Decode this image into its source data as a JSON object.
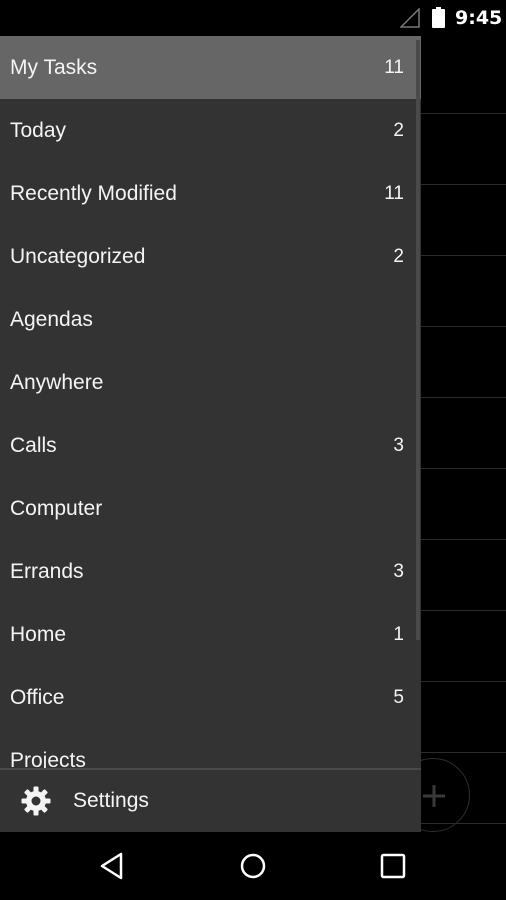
{
  "status_bar": {
    "time": "9:45"
  },
  "drawer": {
    "items": [
      {
        "label": "My Tasks",
        "count": "11",
        "active": true
      },
      {
        "label": "Today",
        "count": "2"
      },
      {
        "label": "Recently Modified",
        "count": "11"
      },
      {
        "label": "Uncategorized",
        "count": "2"
      },
      {
        "label": "Agendas",
        "count": ""
      },
      {
        "label": "Anywhere",
        "count": ""
      },
      {
        "label": "Calls",
        "count": "3"
      },
      {
        "label": "Computer",
        "count": ""
      },
      {
        "label": "Errands",
        "count": "3"
      },
      {
        "label": "Home",
        "count": "1"
      },
      {
        "label": "Office",
        "count": "5"
      },
      {
        "label": "Projects",
        "count": ""
      }
    ],
    "settings_label": "Settings"
  },
  "icons": {
    "signal": "signal-icon",
    "battery": "battery-icon",
    "settings": "gear-icon",
    "fab": "plus-icon",
    "nav_back": "back-triangle-icon",
    "nav_home": "home-circle-icon",
    "nav_recents": "recents-square-icon"
  },
  "colors": {
    "drawer_bg": "#333333",
    "active_item_bg": "#666666",
    "text": "#f4f4f4",
    "screen_bg": "#000000"
  }
}
